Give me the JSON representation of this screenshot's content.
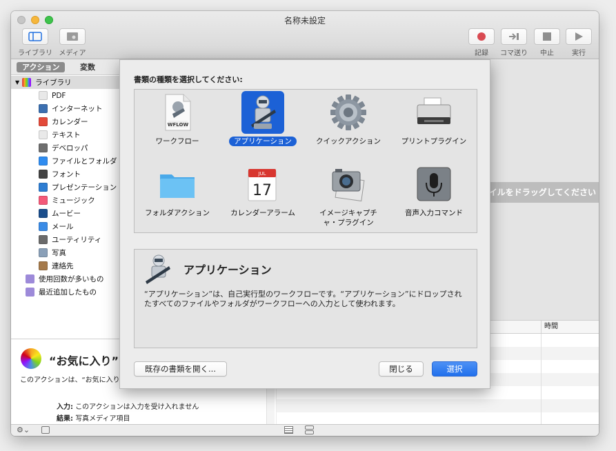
{
  "window": {
    "title": "名称未設定"
  },
  "toolbar": {
    "library_label": "ライブラリ",
    "media_label": "メディア",
    "record_label": "記録",
    "step_label": "コマ送り",
    "stop_label": "中止",
    "run_label": "実行"
  },
  "left": {
    "tab_actions": "アクション",
    "tab_variables": "変数",
    "library_root": "ライブラリ",
    "library_items": [
      {
        "label": "PDF",
        "icon": "pdf-icon",
        "color": "#e8e8e8"
      },
      {
        "label": "インターネット",
        "icon": "globe-icon",
        "color": "#3b6fb0"
      },
      {
        "label": "カレンダー",
        "icon": "calendar-icon",
        "color": "#e34a3a"
      },
      {
        "label": "テキスト",
        "icon": "text-icon",
        "color": "#e9e9e9"
      },
      {
        "label": "デベロッパ",
        "icon": "tools-icon",
        "color": "#6e6e6e"
      },
      {
        "label": "ファイルとフォルダ",
        "icon": "finder-icon",
        "color": "#2f8cf0"
      },
      {
        "label": "フォント",
        "icon": "font-icon",
        "color": "#444444"
      },
      {
        "label": "プレゼンテーション",
        "icon": "keynote-icon",
        "color": "#2d7dd2"
      },
      {
        "label": "ミュージック",
        "icon": "music-icon",
        "color": "#f45a79"
      },
      {
        "label": "ムービー",
        "icon": "movie-icon",
        "color": "#1b4e8c"
      },
      {
        "label": "メール",
        "icon": "mail-icon",
        "color": "#3a8be6"
      },
      {
        "label": "ユーティリティ",
        "icon": "utility-icon",
        "color": "#6b6b6b"
      },
      {
        "label": "写真",
        "icon": "photos-icon",
        "color": "#8aa0b8"
      },
      {
        "label": "連絡先",
        "icon": "contacts-icon",
        "color": "#a57a4b"
      }
    ],
    "groups": [
      {
        "label": "使用回数が多いもの",
        "icon": "smart-folder-icon"
      },
      {
        "label": "最近追加したもの",
        "icon": "smart-folder-icon"
      }
    ],
    "desc_title": "“お気に入り”",
    "desc_body": "このアクションは、“お気に入り”アルバムにある写真への参照を返します。",
    "input_key": "入力:",
    "input_val": "このアクションは入力を受け入れません",
    "result_key": "結果:",
    "result_val": "写真メディア項目"
  },
  "right": {
    "drop_hint": "アクションまたはファイルをドラッグしてください",
    "log_col_time": "時間"
  },
  "sheet": {
    "prompt": "書類の種類を選択してください:",
    "items": [
      {
        "label": "ワークフロー",
        "icon": "workflow-icon"
      },
      {
        "label": "アプリケーション",
        "icon": "automator-robot-icon",
        "selected": true
      },
      {
        "label": "クイックアクション",
        "icon": "gear-icon"
      },
      {
        "label": "プリントプラグイン",
        "icon": "printer-icon"
      },
      {
        "label": "フォルダアクション",
        "icon": "folder-icon"
      },
      {
        "label": "カレンダーアラーム",
        "icon": "calendar-icon"
      },
      {
        "label": "イメージキャプチャ・プラグイン",
        "icon": "camera-icon"
      },
      {
        "label": "音声入力コマンド",
        "icon": "microphone-icon"
      }
    ],
    "badge_text": "WFLOW",
    "cal_month": "JUL",
    "cal_day": "17",
    "info_title": "アプリケーション",
    "info_text": "“アプリケーション”は、自己実行型のワークフローです。“アプリケーション”にドロップされたすべてのファイルやフォルダがワークフローへの入力として使われます。",
    "open_existing": "既存の書類を開く...",
    "close_label": "閉じる",
    "choose_label": "選択",
    "accent": "#1c61d6"
  }
}
